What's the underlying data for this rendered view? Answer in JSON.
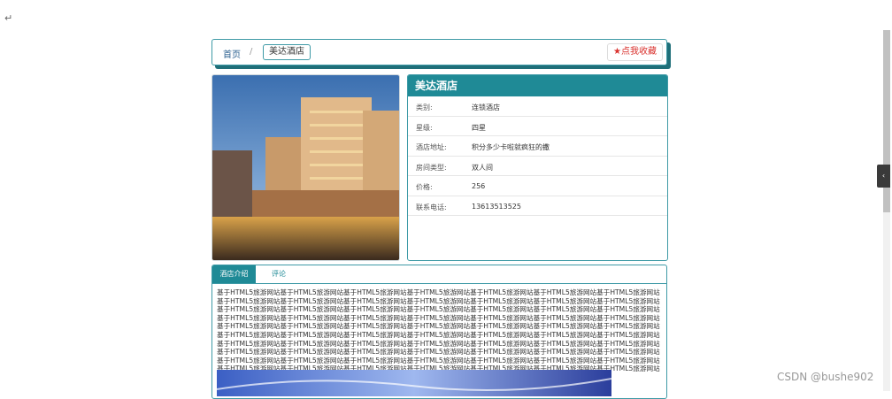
{
  "page": {
    "return_mark": "↵"
  },
  "breadcrumb": {
    "home": "首页",
    "separator": "/",
    "current": "美达酒店"
  },
  "favorite": {
    "icon": "star-icon",
    "label": "点我收藏"
  },
  "hotel": {
    "name": "美达酒店",
    "fields": [
      {
        "key": "类别:",
        "value": "连锁酒店"
      },
      {
        "key": "星级:",
        "value": "四星"
      },
      {
        "key": "酒店地址:",
        "value": "积分多少卡啦就疯狂的撒"
      },
      {
        "key": "房间类型:",
        "value": "双人间"
      },
      {
        "key": "价格:",
        "value": "256"
      },
      {
        "key": "联系电话:",
        "value": "13613513525"
      }
    ]
  },
  "tabs": {
    "intro": "酒店介绍",
    "comments": "评论"
  },
  "description": "基于HTML5旅游网站基于HTML5旅游网站基于HTML5旅游网站基于HTML5旅游网站基于HTML5旅游网站基于HTML5旅游网站基于HTML5旅游网站基于HTML5旅游网站基于HTML5旅游网站基于HTML5旅游网站基于HTML5旅游网站基于HTML5旅游网站基于HTML5旅游网站基于HTML5旅游网站基于HTML5旅游网站基于HTML5旅游网站基于HTML5旅游网站基于HTML5旅游网站基于HTML5旅游网站基于HTML5旅游网站基于HTML5旅游网站基于HTML5旅游网站基于HTML5旅游网站基于HTML5旅游网站基于HTML5旅游网站基于HTML5旅游网站基于HTML5旅游网站基于HTML5旅游网站基于HTML5旅游网站基于HTML5旅游网站基于HTML5旅游网站基于HTML5旅游网站基于HTML5旅游网站基于HTML5旅游网站基于HTML5旅游网站基于HTML5旅游网站基于HTML5旅游网站基于HTML5旅游网站基于HTML5旅游网站基于HTML5旅游网站基于HTML5旅游网站基于HTML5旅游网站基于HTML5旅游网站基于HTML5旅游网站基于HTML5旅游网站基于HTML5旅游网站基于HTML5旅游网站基于HTML5旅游网站基于HTML5旅游网站基于HTML5旅游网站基于HTML5旅游网站基于HTML5旅游网站基于HTML5旅游网站基于HTML5旅游网站基于HTML5旅游网站基于HTML5旅游网站基于HTML5旅游网站基于HTML5旅游网站基于HTML5旅游网站基于HTML5旅游网站基于HTML5旅游网站基于HTML5旅游网站基于HTML5旅游网站基于HTML5旅游网站基于HTML5旅游网站基于HTML5旅游网站基于HTML5旅游网站基于HTML5旅游网站基于HTML5旅游网站基于HTML5旅游网站基于HTML5旅游网站基于HTML5旅游网站基于HTML5旅游网站基于HTML5旅游网站基于HTML5旅游网站基于HTML5旅游网站",
  "sidebar_toggle": {
    "icon": "chevron-left-icon",
    "glyph": "‹"
  },
  "watermark": "CSDN @bushe902",
  "colors": {
    "accent": "#1f8a96",
    "border": "#3e9aa6",
    "favorite": "#d9302c"
  }
}
